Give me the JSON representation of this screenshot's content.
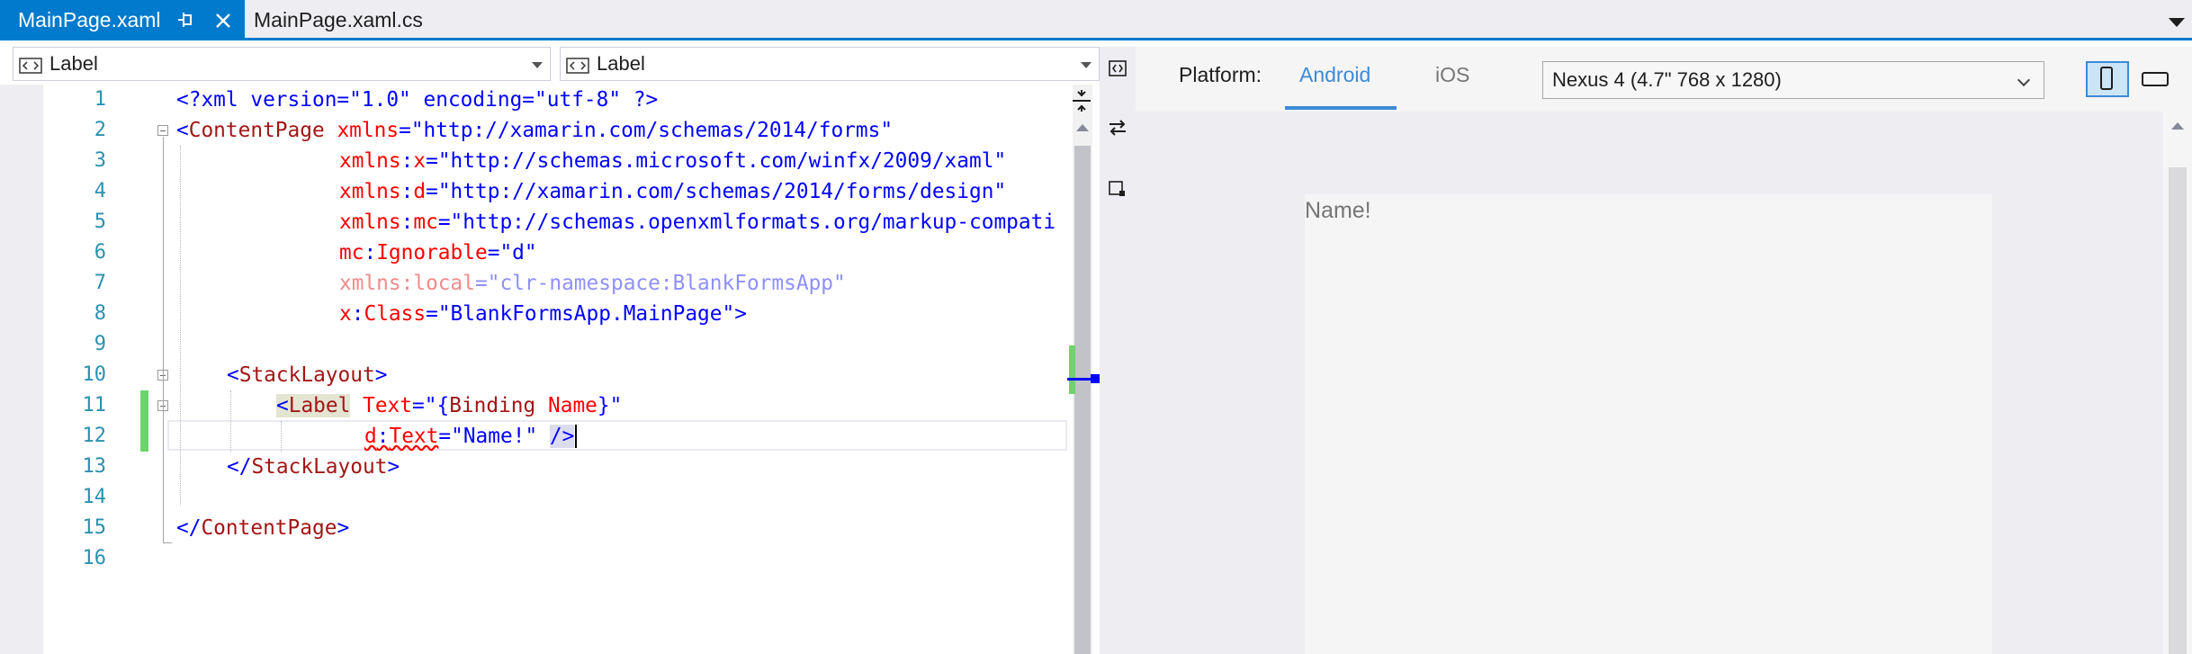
{
  "tabs": [
    {
      "label": "MainPage.xaml",
      "active": true
    },
    {
      "label": "MainPage.xaml.cs",
      "active": false
    }
  ],
  "nav": {
    "left_dropdown": "Label",
    "right_dropdown": "Label"
  },
  "editor": {
    "line_numbers": [
      "1",
      "2",
      "3",
      "4",
      "5",
      "6",
      "7",
      "8",
      "9",
      "10",
      "11",
      "12",
      "13",
      "14",
      "15",
      "16"
    ],
    "lines": {
      "l1": "<?xml version=\"1.0\" encoding=\"utf-8\" ?>",
      "l2": {
        "lt": "<",
        "el": "ContentPage",
        "at": "xmlns",
        "eq": "=",
        "val": "\"http://xamarin.com/schemas/2014/forms\""
      },
      "l3": {
        "at1": "xmlns",
        "col": ":",
        "at2": "x",
        "eq": "=",
        "val": "\"http://schemas.microsoft.com/winfx/2009/xaml\""
      },
      "l4": {
        "at1": "xmlns",
        "col": ":",
        "at2": "d",
        "eq": "=",
        "val": "\"http://xamarin.com/schemas/2014/forms/design\""
      },
      "l5": {
        "at1": "xmlns",
        "col": ":",
        "at2": "mc",
        "eq": "=",
        "val": "\"http://schemas.openxmlformats.org/markup-compati"
      },
      "l6": {
        "at1": "mc",
        "col": ":",
        "at2": "Ignorable",
        "eq": "=",
        "val": "\"d\""
      },
      "l7": {
        "at": "xmlns:local",
        "eq": "=",
        "val": "\"clr-namespace:BlankFormsApp\""
      },
      "l8": {
        "at1": "x",
        "col": ":",
        "at2": "Class",
        "eq": "=",
        "val": "\"BlankFormsApp.MainPage\"",
        "close": ">"
      },
      "l10": {
        "lt": "<",
        "el": "StackLayout",
        "gt": ">"
      },
      "l11": {
        "lt": "<",
        "el": "Label",
        "at": "Text",
        "eq": "=",
        "val1": "\"{",
        "val2": "Binding",
        "val3": "Name",
        "val4": "}\""
      },
      "l12": {
        "at1": "d",
        "col": ":",
        "at2": "Text",
        "eq": "=",
        "val": "\"Name!\"",
        "close": "/>"
      },
      "l13": {
        "lt": "</",
        "el": "StackLayout",
        "gt": ">"
      },
      "l15": {
        "lt": "</",
        "el": "ContentPage",
        "gt": ">"
      }
    }
  },
  "previewer": {
    "platform_label": "Platform:",
    "platform_tabs": [
      {
        "label": "Android",
        "selected": true
      },
      {
        "label": "iOS",
        "selected": false
      }
    ],
    "device": "Nexus 4 (4.7\" 768 x 1280)",
    "orientation": "portrait",
    "preview_text": "Name!"
  },
  "colors": {
    "accent": "#007acc",
    "xml_element": "#a31515",
    "xml_attribute": "#ff0000",
    "xml_value": "#0000ff",
    "line_number": "#2b91af",
    "change_marker": "#6dd36d",
    "previewer_tab": "#3c8ad6"
  }
}
